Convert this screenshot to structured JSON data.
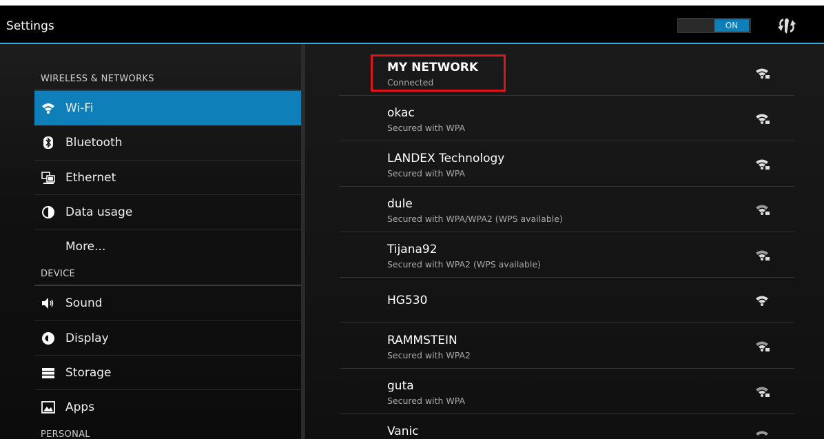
{
  "window": {
    "title": "Settings"
  },
  "actionbar": {
    "wifi_toggle_label": "ON",
    "sync_icon": "sync-icon"
  },
  "sidebar": {
    "sections": [
      {
        "header": "WIRELESS & NETWORKS"
      },
      {
        "header": "DEVICE"
      },
      {
        "header": "PERSONAL"
      }
    ],
    "items": [
      {
        "label": "Wi-Fi",
        "icon": "wifi-icon",
        "selected": true
      },
      {
        "label": "Bluetooth",
        "icon": "bluetooth-icon"
      },
      {
        "label": "Ethernet",
        "icon": "ethernet-icon"
      },
      {
        "label": "Data usage",
        "icon": "data-usage-icon"
      },
      {
        "label": "More...",
        "icon": ""
      },
      {
        "label": "Sound",
        "icon": "sound-icon"
      },
      {
        "label": "Display",
        "icon": "display-icon"
      },
      {
        "label": "Storage",
        "icon": "storage-icon"
      },
      {
        "label": "Apps",
        "icon": "apps-icon"
      }
    ]
  },
  "networks": [
    {
      "name": "MY NETWORK",
      "status": "Connected",
      "locked": true
    },
    {
      "name": "okac",
      "status": "Secured with WPA",
      "locked": true
    },
    {
      "name": "LANDEX Technology",
      "status": "Secured with WPA",
      "locked": true
    },
    {
      "name": "dule",
      "status": "Secured with WPA/WPA2 (WPS available)",
      "locked": true
    },
    {
      "name": "Tijana92",
      "status": "Secured with WPA2 (WPS available)",
      "locked": true
    },
    {
      "name": "HG530",
      "status": "",
      "locked": false
    },
    {
      "name": "RAMMSTEIN",
      "status": "Secured with WPA2",
      "locked": true
    },
    {
      "name": "guta",
      "status": "Secured with WPA",
      "locked": true
    },
    {
      "name": "Vanic",
      "status": "",
      "locked": false
    }
  ],
  "colors": {
    "accent": "#33b5e5",
    "selected": "#0e7fb8",
    "highlight": "#e0141c"
  }
}
